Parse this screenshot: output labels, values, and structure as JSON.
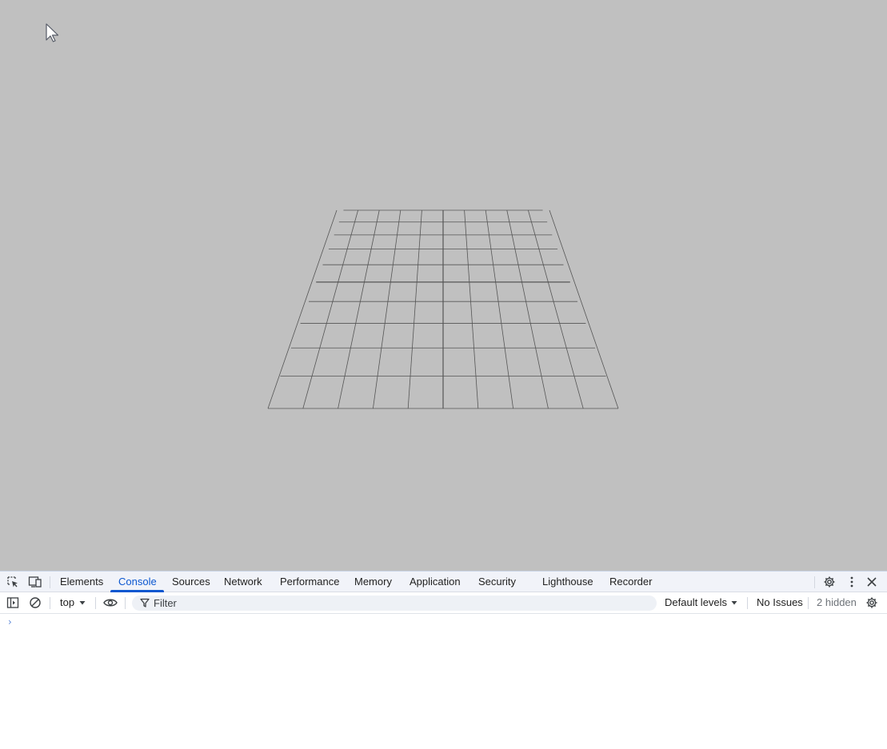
{
  "devtools": {
    "tabs": [
      {
        "label": "Elements"
      },
      {
        "label": "Console"
      },
      {
        "label": "Sources"
      },
      {
        "label": "Network"
      },
      {
        "label": "Performance"
      },
      {
        "label": "Memory"
      },
      {
        "label": "Application"
      },
      {
        "label": "Security"
      },
      {
        "label": "Lighthouse"
      },
      {
        "label": "Recorder"
      }
    ],
    "active_tab": "Console",
    "toolbar": {
      "context": "top",
      "filter_placeholder": "Filter",
      "levels": "Default levels",
      "issues": "No Issues",
      "hidden": "2 hidden"
    },
    "prompt_symbol": "›"
  },
  "colors": {
    "viewport_bg": "#c0c0c0",
    "grid_line": "#555555",
    "accent": "#0b57d0"
  },
  "icons": [
    "inspect-element-icon",
    "device-toolbar-icon",
    "settings-gear-icon",
    "more-vert-icon",
    "close-icon",
    "sidebar-toggle-icon",
    "clear-console-icon",
    "dropdown-arrow-icon",
    "live-expression-eye-icon",
    "filter-funnel-icon",
    "console-settings-gear-icon",
    "cursor-arrow-icon"
  ]
}
